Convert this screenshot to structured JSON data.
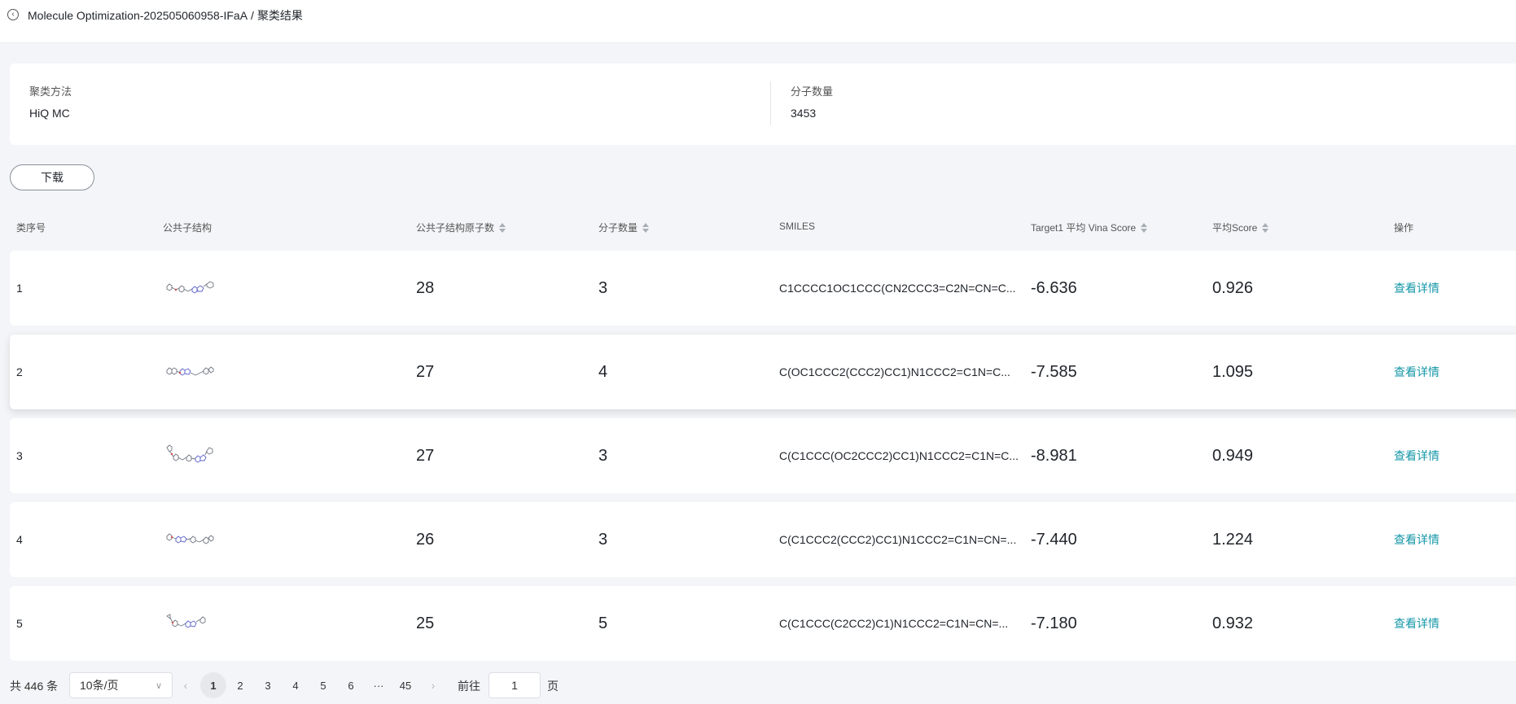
{
  "header": {
    "title": "Molecule Optimization-202505060958-IFaA",
    "separator": "/",
    "current": "聚类结果"
  },
  "info": {
    "method_label": "聚类方法",
    "method_value": "HiQ MC",
    "count_label": "分子数量",
    "count_value": "3453"
  },
  "download_label": "下载",
  "columns": {
    "index": "类序号",
    "structure": "公共子结构",
    "atoms": "公共子结构原子数",
    "count": "分子数量",
    "smiles": "SMILES",
    "vina": "Target1 平均 Vina Score",
    "score": "平均Score",
    "op": "操作"
  },
  "rows": [
    {
      "index": "1",
      "atoms": "28",
      "count": "3",
      "smiles": "C1CCCC1OC1CCC(CN2CCC3=C2N=CN=C...",
      "vina": "-6.636",
      "score": "0.926",
      "op": "查看详情"
    },
    {
      "index": "2",
      "atoms": "27",
      "count": "4",
      "smiles": "C(OC1CCC2(CCC2)CC1)N1CCC2=C1N=C...",
      "vina": "-7.585",
      "score": "1.095",
      "op": "查看详情"
    },
    {
      "index": "3",
      "atoms": "27",
      "count": "3",
      "smiles": "C(C1CCC(OC2CCC2)CC1)N1CCC2=C1N=C...",
      "vina": "-8.981",
      "score": "0.949",
      "op": "查看详情"
    },
    {
      "index": "4",
      "atoms": "26",
      "count": "3",
      "smiles": "C(C1CCC2(CCC2)CC1)N1CCC2=C1N=CN=...",
      "vina": "-7.440",
      "score": "1.224",
      "op": "查看详情"
    },
    {
      "index": "5",
      "atoms": "25",
      "count": "5",
      "smiles": "C(C1CCC(C2CC2)C1)N1CCC2=C1N=CN=...",
      "vina": "-7.180",
      "score": "0.932",
      "op": "查看详情"
    }
  ],
  "pagination": {
    "total": "共 446 条",
    "page_size": "10条/页",
    "prev": "‹",
    "pages": [
      "1",
      "2",
      "3",
      "4",
      "5",
      "6"
    ],
    "ellipsis": "···",
    "last": "45",
    "next": "›",
    "goto_label": "前往",
    "goto_value": "1",
    "page_unit": "页"
  },
  "colors": {
    "accent": "#1597a8",
    "background": "#f4f5f8"
  }
}
